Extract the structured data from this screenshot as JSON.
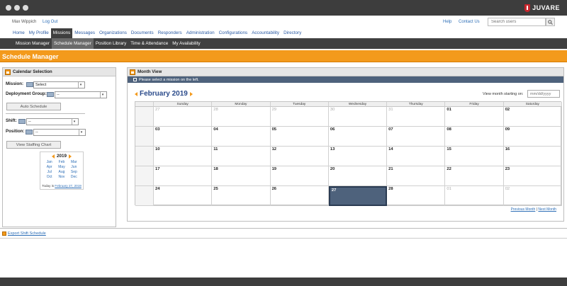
{
  "window": {
    "brand": "JUVARE"
  },
  "topbar": {
    "user": "Max Wippich",
    "logout": "Log Out",
    "help": "Help",
    "contact": "Contact Us",
    "search_placeholder": "Search users"
  },
  "mainnav": [
    "Home",
    "My Profile",
    "Missions",
    "Messages",
    "Organizations",
    "Documents",
    "Responders",
    "Administration",
    "Configurations",
    "Accountability",
    "Directory"
  ],
  "mainnav_active": "Missions",
  "subnav": [
    "Mission Manager",
    "Schedule Manager",
    "Position Library",
    "Time & Attendance",
    "My Availability"
  ],
  "subnav_active": "Schedule Manager",
  "page_title": "Schedule Manager",
  "calendar_selection": {
    "title": "Calendar Selection",
    "mission_label": "Mission:",
    "mission_value": "Select",
    "deployment_label": "Deployment Group:",
    "deployment_value": "--",
    "auto_schedule": "Auto Schedule",
    "shift_label": "Shift:",
    "shift_value": "--",
    "position_label": "Position:",
    "position_value": "--",
    "view_staffing": "View Staffing Chart",
    "mini_year": "2019",
    "months": [
      "Jan",
      "Feb",
      "Mar",
      "Apr",
      "May",
      "Jun",
      "Jul",
      "Aug",
      "Sep",
      "Oct",
      "Nov",
      "Dec"
    ],
    "today_prefix": "Today is",
    "today_link": "February 27, 2019"
  },
  "month_view": {
    "title": "Month View",
    "message": "Please select a mission on the left.",
    "month_title": "February 2019",
    "view_month_label": "View month starting on:",
    "date_placeholder": "mm/dd/yyyy",
    "days": [
      "Sunday",
      "Monday",
      "Tuesday",
      "Wednesday",
      "Thursday",
      "Friday",
      "Saturday"
    ],
    "weeks": [
      [
        {
          "d": "27",
          "o": true
        },
        {
          "d": "28",
          "o": true
        },
        {
          "d": "29",
          "o": true
        },
        {
          "d": "30",
          "o": true
        },
        {
          "d": "31",
          "o": true
        },
        {
          "d": "01",
          "o": false
        },
        {
          "d": "02",
          "o": false
        }
      ],
      [
        {
          "d": "03",
          "o": false
        },
        {
          "d": "04",
          "o": false
        },
        {
          "d": "05",
          "o": false
        },
        {
          "d": "06",
          "o": false
        },
        {
          "d": "07",
          "o": false
        },
        {
          "d": "08",
          "o": false
        },
        {
          "d": "09",
          "o": false
        }
      ],
      [
        {
          "d": "10",
          "o": false
        },
        {
          "d": "11",
          "o": false
        },
        {
          "d": "12",
          "o": false
        },
        {
          "d": "13",
          "o": false
        },
        {
          "d": "14",
          "o": false
        },
        {
          "d": "15",
          "o": false
        },
        {
          "d": "16",
          "o": false
        }
      ],
      [
        {
          "d": "17",
          "o": false
        },
        {
          "d": "18",
          "o": false
        },
        {
          "d": "19",
          "o": false
        },
        {
          "d": "20",
          "o": false
        },
        {
          "d": "21",
          "o": false
        },
        {
          "d": "22",
          "o": false
        },
        {
          "d": "23",
          "o": false
        }
      ],
      [
        {
          "d": "24",
          "o": false
        },
        {
          "d": "25",
          "o": false
        },
        {
          "d": "26",
          "o": false
        },
        {
          "d": "27",
          "o": false,
          "today": true
        },
        {
          "d": "28",
          "o": false
        },
        {
          "d": "01",
          "o": true
        },
        {
          "d": "02",
          "o": true
        }
      ]
    ],
    "prev_month": "Previous Month",
    "separator": "|",
    "next_month": "Next Month"
  },
  "export_link": "Export Shift Schedule",
  "colors": {
    "accent": "#f39a1c",
    "nav_dark": "#404040",
    "link": "#2e6fb7",
    "today_cell": "#4e627c"
  }
}
